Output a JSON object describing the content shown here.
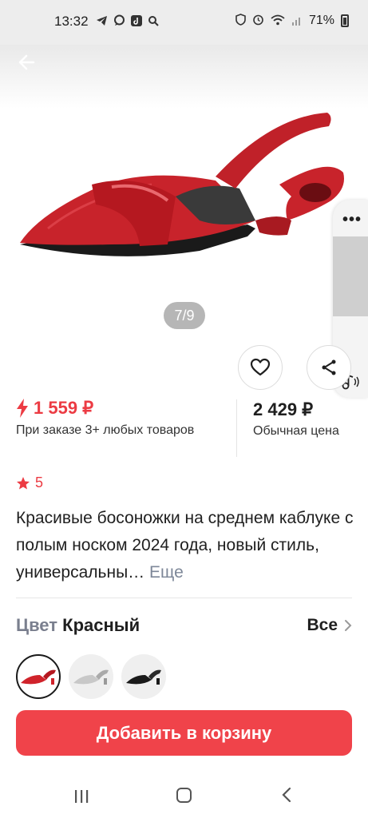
{
  "status_bar": {
    "time": "13:32",
    "battery": "71%",
    "left_icons": [
      "telegram-icon",
      "chat-icon",
      "tiktok-icon",
      "search-icon"
    ],
    "right_icons": [
      "vpn-icon",
      "alarm-icon",
      "wifi-icon",
      "signal-icon",
      "battery-icon"
    ]
  },
  "gallery": {
    "page_indicator": "7/9",
    "current_image": 7,
    "total_images": 9
  },
  "price": {
    "sale": "1 559 ₽",
    "sale_note": "При заказе 3+ любых товаров",
    "regular": "2 429 ₽",
    "regular_note": "Обычная цена"
  },
  "rating": {
    "value": "5"
  },
  "description": {
    "text": "Красивые босоножки на среднем каблуке с полым носком 2024 года, новый стиль, универсальны…",
    "more_label": "Еще"
  },
  "color": {
    "key_label": "Цвет",
    "value": "Красный",
    "all_label": "Все"
  },
  "swatches": [
    {
      "name": "red",
      "color": "#d0232b"
    },
    {
      "name": "silver",
      "color": "#c8c8c8"
    },
    {
      "name": "black",
      "color": "#1a1a1a"
    }
  ],
  "cart": {
    "label": "Добавить в корзину"
  },
  "colors": {
    "accent": "#f0434a",
    "price_red": "#ec3b43",
    "muted": "#7d8798"
  }
}
